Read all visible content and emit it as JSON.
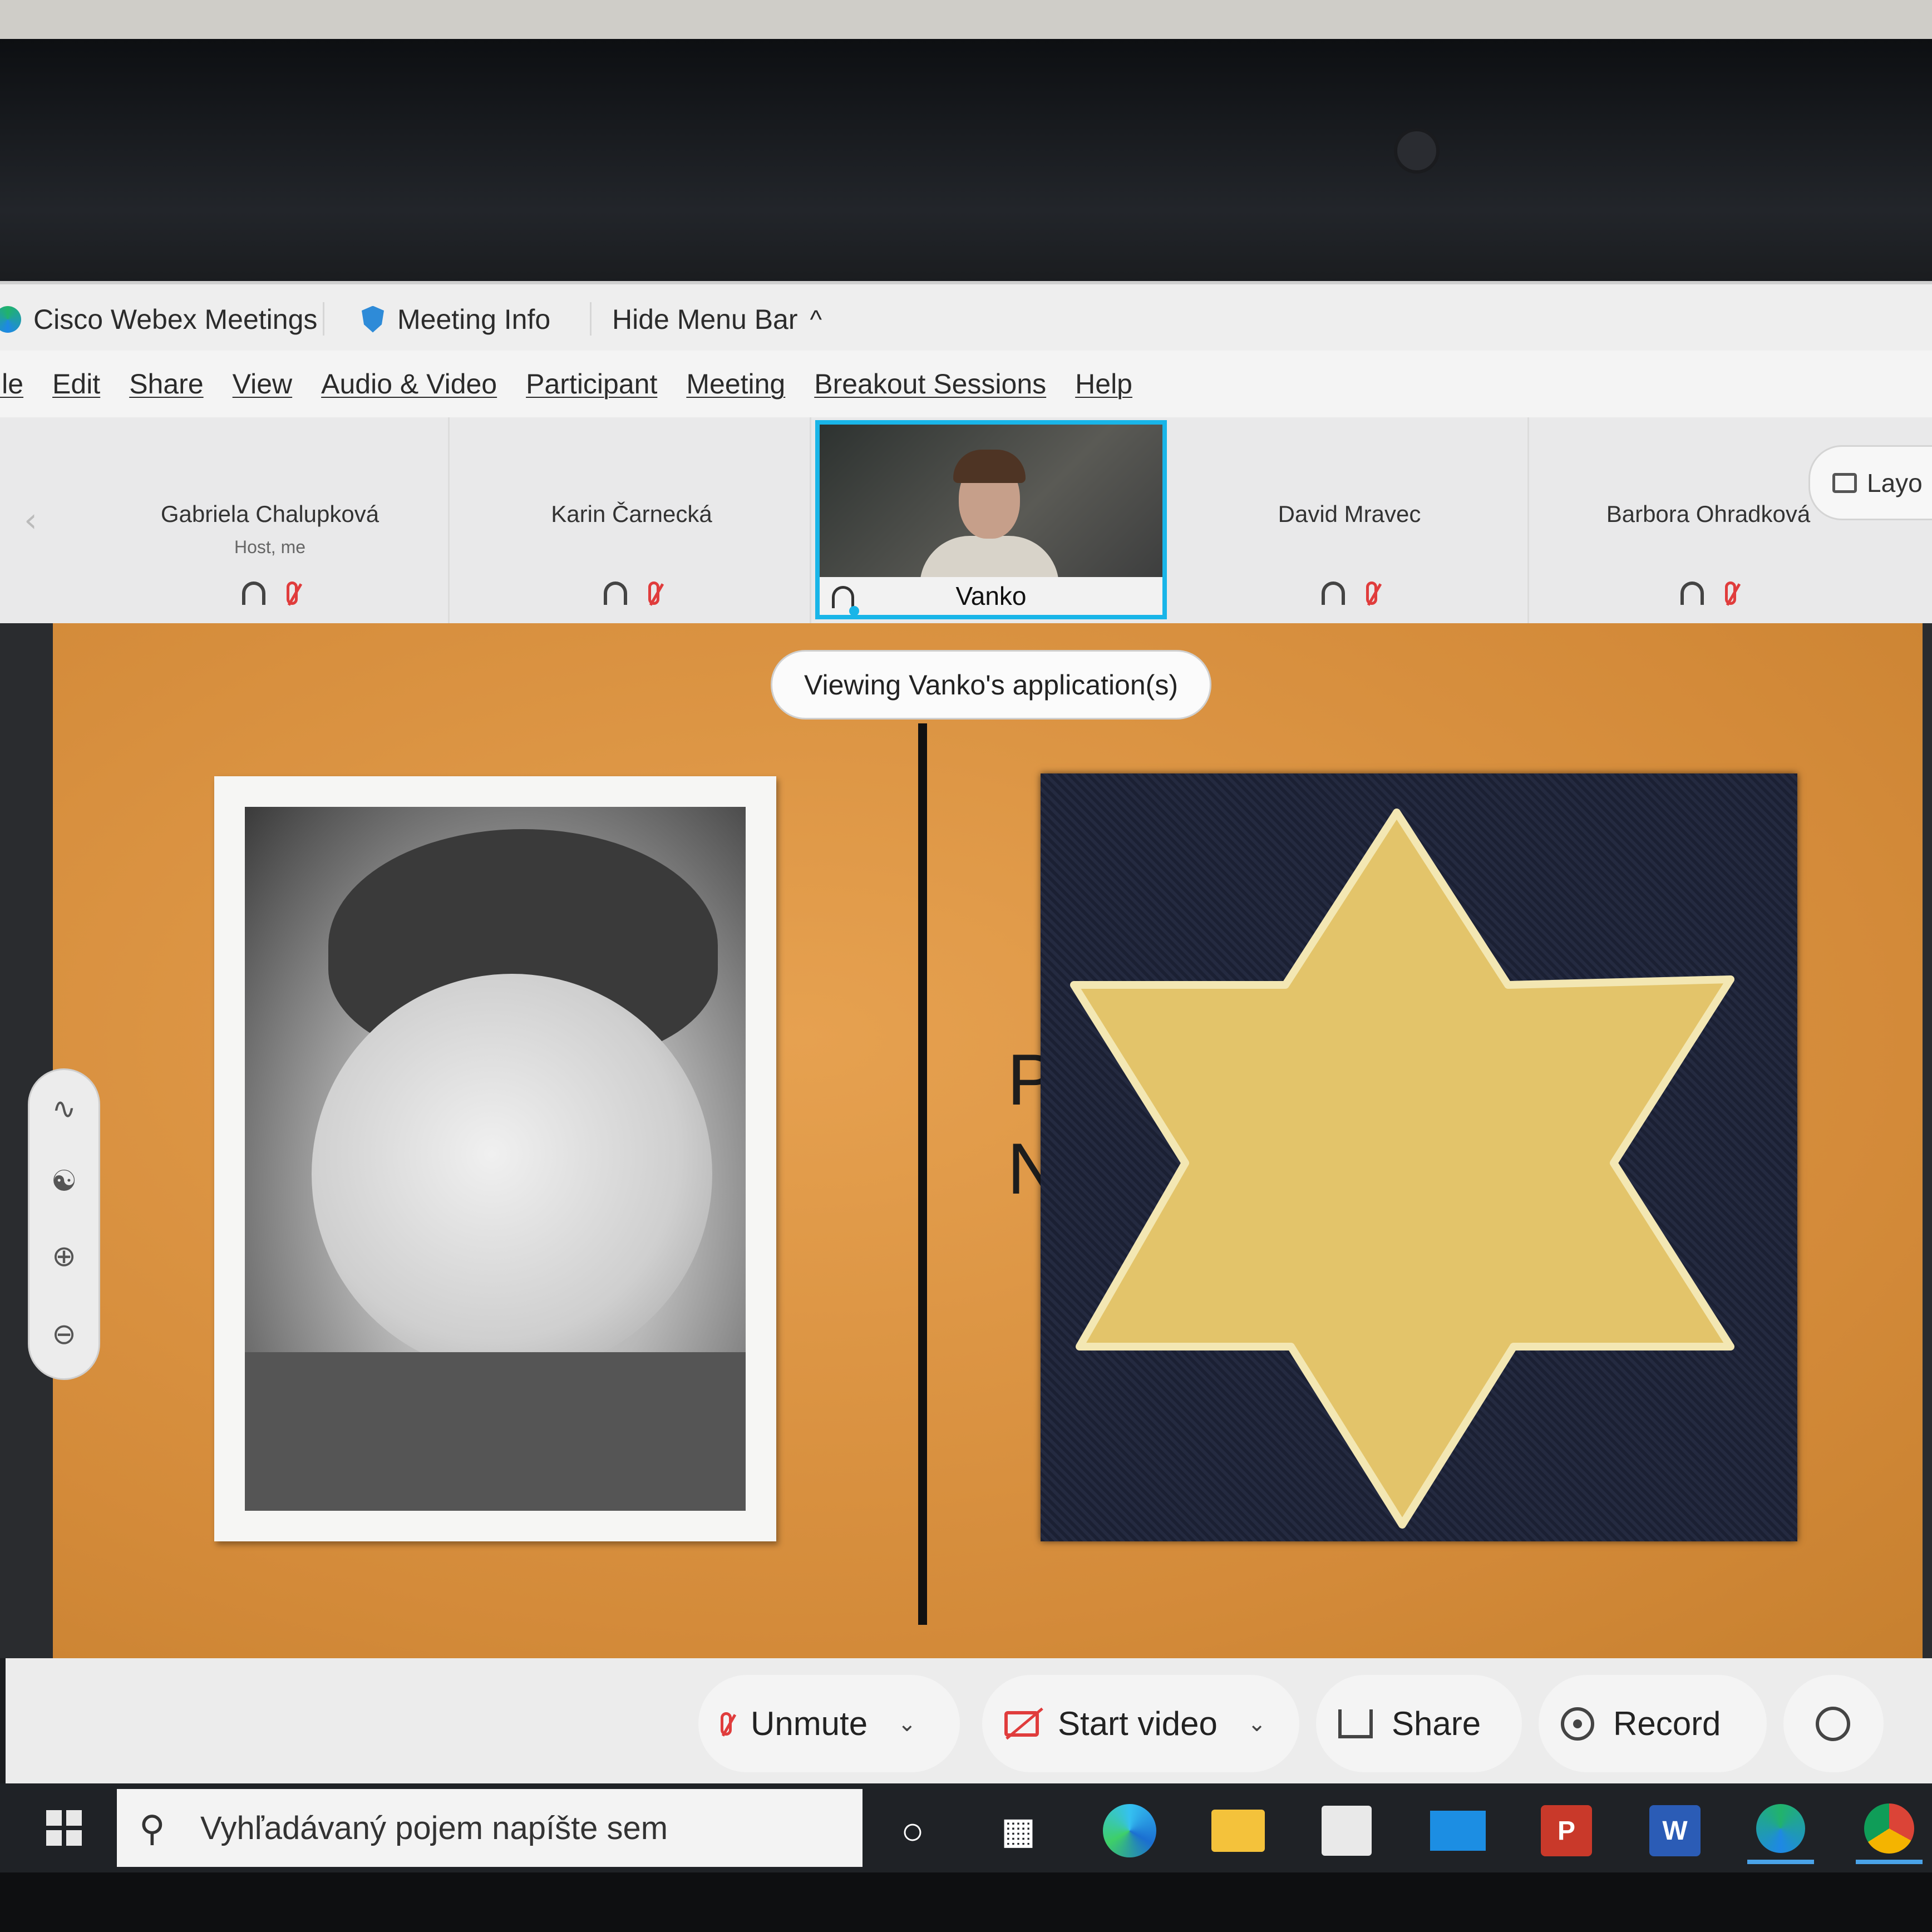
{
  "titlebar": {
    "app_name": "Cisco Webex Meetings",
    "meeting_info": "Meeting Info",
    "hide_menu_bar": "Hide Menu Bar"
  },
  "menubar": {
    "items": [
      "ile",
      "Edit",
      "Share",
      "View",
      "Audio & Video",
      "Participant",
      "Meeting",
      "Breakout Sessions",
      "Help"
    ]
  },
  "participants": [
    {
      "name": "Gabriela Chalupková",
      "role": "Host, me"
    },
    {
      "name": "Karin Čarnecká",
      "role": ""
    },
    {
      "name": "Vanko",
      "role": ""
    },
    {
      "name": "David Mravec",
      "role": ""
    },
    {
      "name": "Barbora Ohradková",
      "role": ""
    }
  ],
  "layout_button": "Layo",
  "viewing_banner": "Viewing Vanko's application(s)",
  "slide": {
    "partial_letters": [
      "P",
      "N"
    ]
  },
  "controls": {
    "unmute": "Unmute",
    "start_video": "Start video",
    "share": "Share",
    "record": "Record"
  },
  "taskbar": {
    "search_placeholder": "Vyhľadávaný pojem napíšte sem",
    "app_icons": [
      "cortana-icon",
      "task-view-icon",
      "edge-icon",
      "file-explorer-icon",
      "store-icon",
      "mail-icon",
      "powerpoint-icon",
      "word-icon",
      "webex-icon",
      "chrome-icon"
    ]
  },
  "colors": {
    "active_speaker_border": "#19b5e8",
    "muted_red": "#e03c3c",
    "slide_orange": "#d9913f"
  }
}
